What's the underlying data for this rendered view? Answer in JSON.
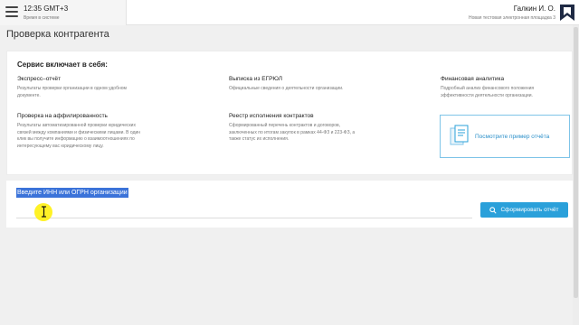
{
  "header": {
    "time": "12:35 GMT+3",
    "time_caption": "Время в системе",
    "user_name": "Галкин И. О.",
    "user_caption": "Новая тестовая электронная площадка 3"
  },
  "page": {
    "title": "Проверка контрагента"
  },
  "services": {
    "heading": "Сервис включает в себя:",
    "items": [
      {
        "title": "Экспресс–отчёт",
        "description": "Результаты проверки организации в одном удобном документе."
      },
      {
        "title": "Выписка из ЕГРЮЛ",
        "description": "Официальные сведения о деятельности организации."
      },
      {
        "title": "Финансовая аналитика",
        "description": "Подробный анализ финансового положения эффективности деятельности организации."
      },
      {
        "title": "Проверка на аффилированность",
        "description": "Результаты автоматизированной проверки юридических связей между компаниями и физическими лицами. В один клик вы получите информацию о взаимоотношениях по интересующему вас юридическому лицу."
      },
      {
        "title": "Реестр исполнения контрактов",
        "description": "Сформированный перечень контрактов и договоров, заключенных по итогам закупок в рамках 44-ФЗ и 223-ФЗ, а также статус их исполнения."
      }
    ],
    "sample_link": "Посмотрите пример отчёта"
  },
  "form": {
    "label": "Введите ИНН или ОГРН организации",
    "value": "",
    "submit_label": "Сформировать отчёт"
  },
  "colors": {
    "accent": "#2aa0da",
    "selection": "#3b73d9",
    "cursor_highlight": "#fff000"
  },
  "icons": [
    "menu-icon",
    "brand-logo",
    "document-icon",
    "search-icon",
    "text-cursor-icon"
  ]
}
